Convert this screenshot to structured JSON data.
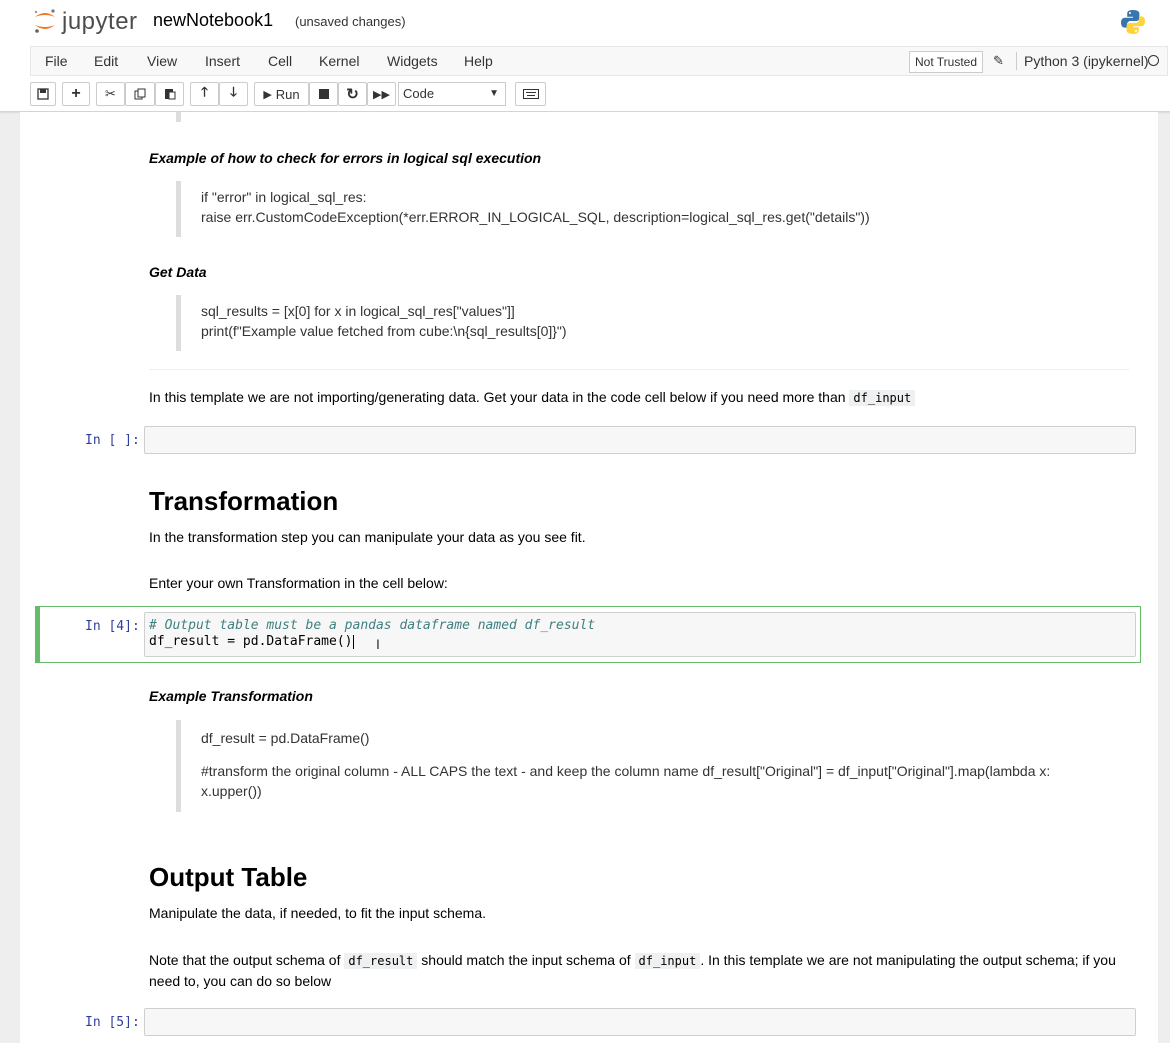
{
  "app": {
    "logo_text": "jupyter",
    "notebook_name": "newNotebook1",
    "save_status": "(unsaved changes)"
  },
  "menu": {
    "items": [
      "File",
      "Edit",
      "View",
      "Insert",
      "Cell",
      "Kernel",
      "Widgets",
      "Help"
    ],
    "not_trusted": "Not Trusted",
    "kernel_name": "Python 3 (ipykernel)"
  },
  "toolbar": {
    "run_label": "Run",
    "cell_type": "Code"
  },
  "cells": {
    "error_heading": "Example of how to check for errors in logical sql execution",
    "error_code_1": "if \"error\" in logical_sql_res:",
    "error_code_2": "raise err.CustomCodeException(*err.ERROR_IN_LOGICAL_SQL, description=logical_sql_res.get(\"details\"))",
    "getdata_heading": "Get Data",
    "getdata_code_1": "sql_results = [x[0] for x in logical_sql_res[\"values\"]]",
    "getdata_code_2": "print(f\"Example value fetched from cube:\\n{sql_results[0]}\")",
    "template_note": "In this template we are not importing/generating data. Get your data in the code cell below if you need more than",
    "template_note_code": "df_input",
    "prompt_empty": "In [ ]:",
    "transformation_heading": "Transformation",
    "transformation_desc": "In the transformation step you can manipulate your data as you see fit.",
    "transformation_enter": "Enter your own Transformation in the cell below:",
    "prompt_4": "In [4]:",
    "cell4_comment": "# Output table must be a pandas dataframe named df_result",
    "cell4_code": "df_result = pd.DataFrame()",
    "example_transformation_heading": "Example Transformation",
    "example_code_1": "df_result = pd.DataFrame()",
    "example_code_2": "#transform the original column - ALL CAPS the text - and keep the column name df_result[\"Original\"] = df_input[\"Original\"].map(lambda x:",
    "example_code_3": "x.upper())",
    "output_table_heading": "Output Table",
    "output_desc": "Manipulate the data, if needed, to fit the input schema.",
    "note_part1": "Note that the output schema of",
    "note_code1": "df_result",
    "note_part2": "should match the input schema of",
    "note_code2": "df_input",
    "note_part3": ". In this template we are not manipulating the output schema; if you",
    "note_part4": "need to, you can do so below",
    "prompt_5": "In [5]:"
  }
}
